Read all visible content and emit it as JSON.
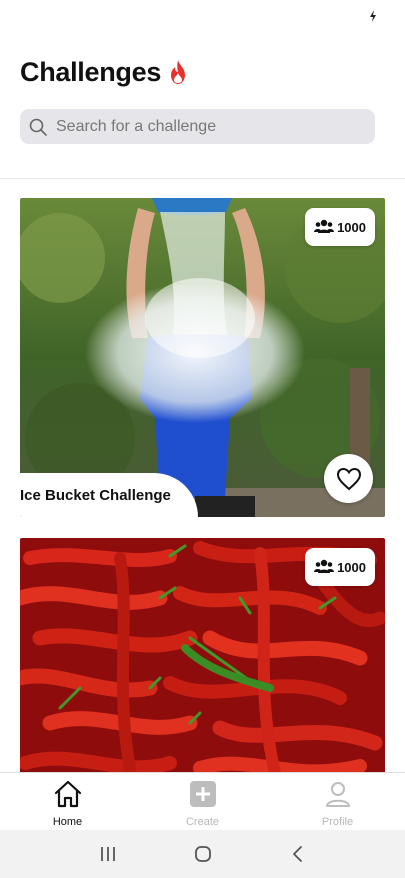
{
  "status_bar": {
    "icons": [
      "charging-icon"
    ]
  },
  "header": {
    "title": "Challenges",
    "title_icon": "fire-icon",
    "accent": "#e5322d"
  },
  "search": {
    "placeholder": "Search for a challenge",
    "value": "",
    "icon": "search-icon"
  },
  "challenges": [
    {
      "title": "Ice Bucket Challenge",
      "participants": "1000",
      "image": "person pouring bucket of ice water over head",
      "liked": false
    },
    {
      "title": "",
      "participants": "1000",
      "image": "pile of red chili peppers",
      "liked": false
    }
  ],
  "tab_bar": {
    "tabs": [
      {
        "label": "Home",
        "icon": "home-icon",
        "active": true
      },
      {
        "label": "Create",
        "icon": "plus-square-icon",
        "active": false
      },
      {
        "label": "Profile",
        "icon": "user-icon",
        "active": false
      }
    ]
  },
  "system_nav": {
    "buttons": [
      "recents-icon",
      "home-circle-icon",
      "back-icon"
    ]
  },
  "colors": {
    "active_tab": "#111111",
    "inactive_tab": "#b8b8b8",
    "search_bg": "#e6e6ea"
  }
}
